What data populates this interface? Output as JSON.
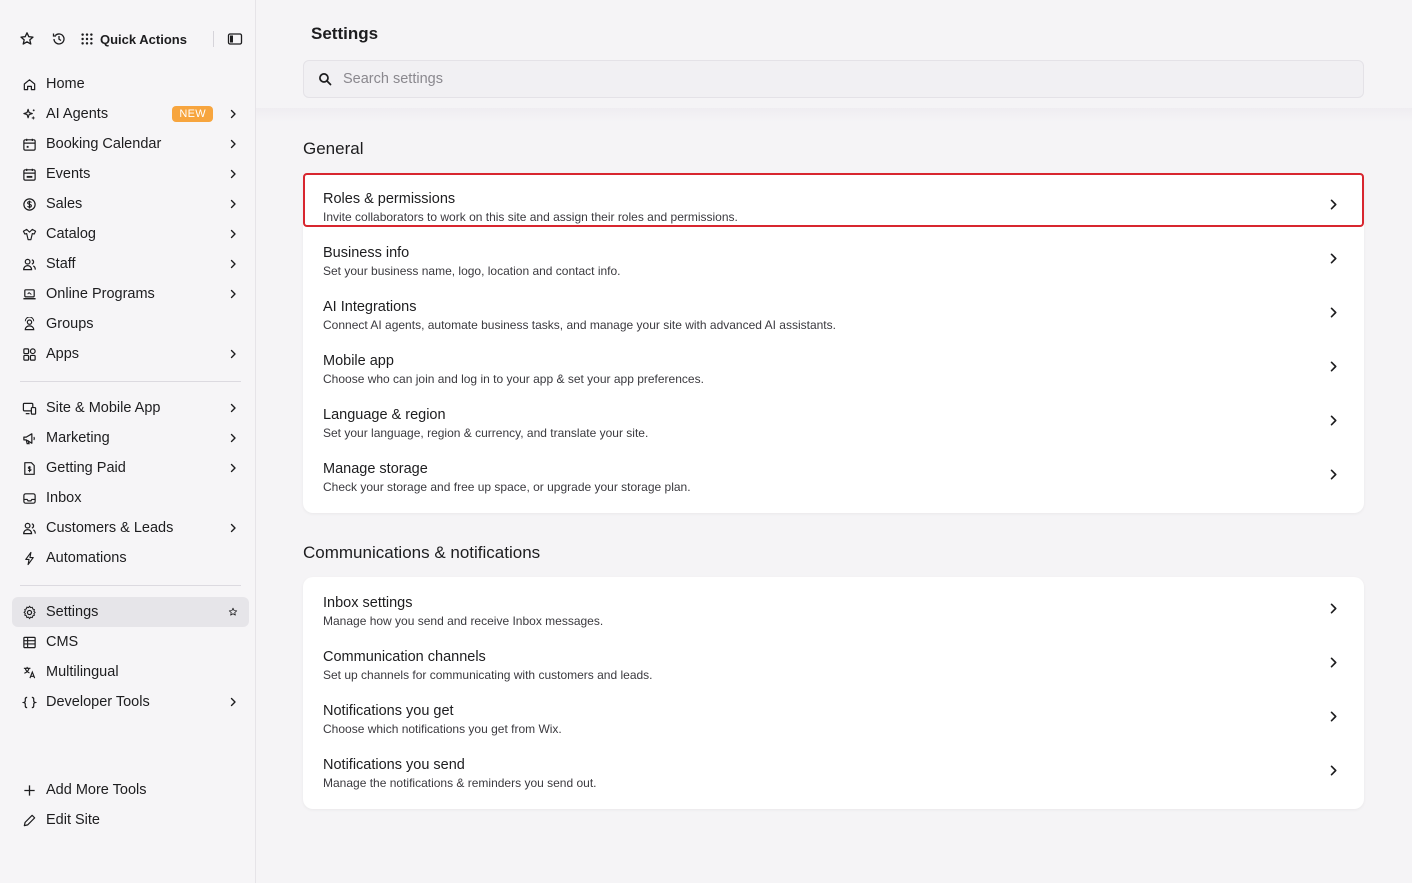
{
  "topbar": {
    "quick_actions_label": "Quick Actions"
  },
  "nav_main": [
    {
      "label": "Home",
      "icon": "home-icon",
      "chevron": false
    },
    {
      "label": "AI Agents",
      "icon": "sparkle-icon",
      "chevron": true,
      "badge": "NEW"
    },
    {
      "label": "Booking Calendar",
      "icon": "calendar-icon",
      "chevron": true
    },
    {
      "label": "Events",
      "icon": "calendar-event-icon",
      "chevron": true
    },
    {
      "label": "Sales",
      "icon": "dollar-icon",
      "chevron": true
    },
    {
      "label": "Catalog",
      "icon": "catalog-icon",
      "chevron": true
    },
    {
      "label": "Staff",
      "icon": "staff-icon",
      "chevron": true
    },
    {
      "label": "Online Programs",
      "icon": "laptop-icon",
      "chevron": true
    },
    {
      "label": "Groups",
      "icon": "groups-icon",
      "chevron": false
    },
    {
      "label": "Apps",
      "icon": "apps-icon",
      "chevron": true
    }
  ],
  "nav_secondary": [
    {
      "label": "Site & Mobile App",
      "icon": "devices-icon",
      "chevron": true
    },
    {
      "label": "Marketing",
      "icon": "megaphone-icon",
      "chevron": true
    },
    {
      "label": "Getting Paid",
      "icon": "invoice-icon",
      "chevron": true
    },
    {
      "label": "Inbox",
      "icon": "inbox-icon",
      "chevron": false
    },
    {
      "label": "Customers & Leads",
      "icon": "customers-icon",
      "chevron": true
    },
    {
      "label": "Automations",
      "icon": "lightning-icon",
      "chevron": false
    }
  ],
  "nav_tertiary": [
    {
      "label": "Settings",
      "icon": "gear-icon",
      "active": true
    },
    {
      "label": "CMS",
      "icon": "table-icon",
      "chevron": false
    },
    {
      "label": "Multilingual",
      "icon": "translate-icon",
      "chevron": false
    },
    {
      "label": "Developer Tools",
      "icon": "braces-icon",
      "chevron": true
    }
  ],
  "nav_bottom": [
    {
      "label": "Add More Tools",
      "icon": "plus-icon"
    },
    {
      "label": "Edit Site",
      "icon": "pencil-icon"
    }
  ],
  "page": {
    "title": "Settings",
    "search_placeholder": "Search settings"
  },
  "sections": [
    {
      "title": "General",
      "rows": [
        {
          "title": "Roles & permissions",
          "desc": "Invite collaborators to work on this site and assign their roles and permissions.",
          "highlighted": true
        },
        {
          "title": "Business info",
          "desc": "Set your business name, logo, location and contact info."
        },
        {
          "title": "AI Integrations",
          "desc": "Connect AI agents, automate business tasks, and manage your site with advanced AI assistants."
        },
        {
          "title": "Mobile app",
          "desc": "Choose who can join and log in to your app & set your app preferences."
        },
        {
          "title": "Language & region",
          "desc": "Set your language, region & currency, and translate your site."
        },
        {
          "title": "Manage storage",
          "desc": "Check your storage and free up space, or upgrade your storage plan."
        }
      ]
    },
    {
      "title": "Communications & notifications",
      "rows": [
        {
          "title": "Inbox settings",
          "desc": "Manage how you send and receive Inbox messages."
        },
        {
          "title": "Communication channels",
          "desc": "Set up channels for communicating with customers and leads."
        },
        {
          "title": "Notifications you get",
          "desc": "Choose which notifications you get from Wix."
        },
        {
          "title": "Notifications you send",
          "desc": "Manage the notifications & reminders you send out."
        }
      ]
    }
  ],
  "colors": {
    "highlight_border": "#d8262f",
    "badge": "#f7a53e",
    "active_nav": "#e6e5e9"
  }
}
